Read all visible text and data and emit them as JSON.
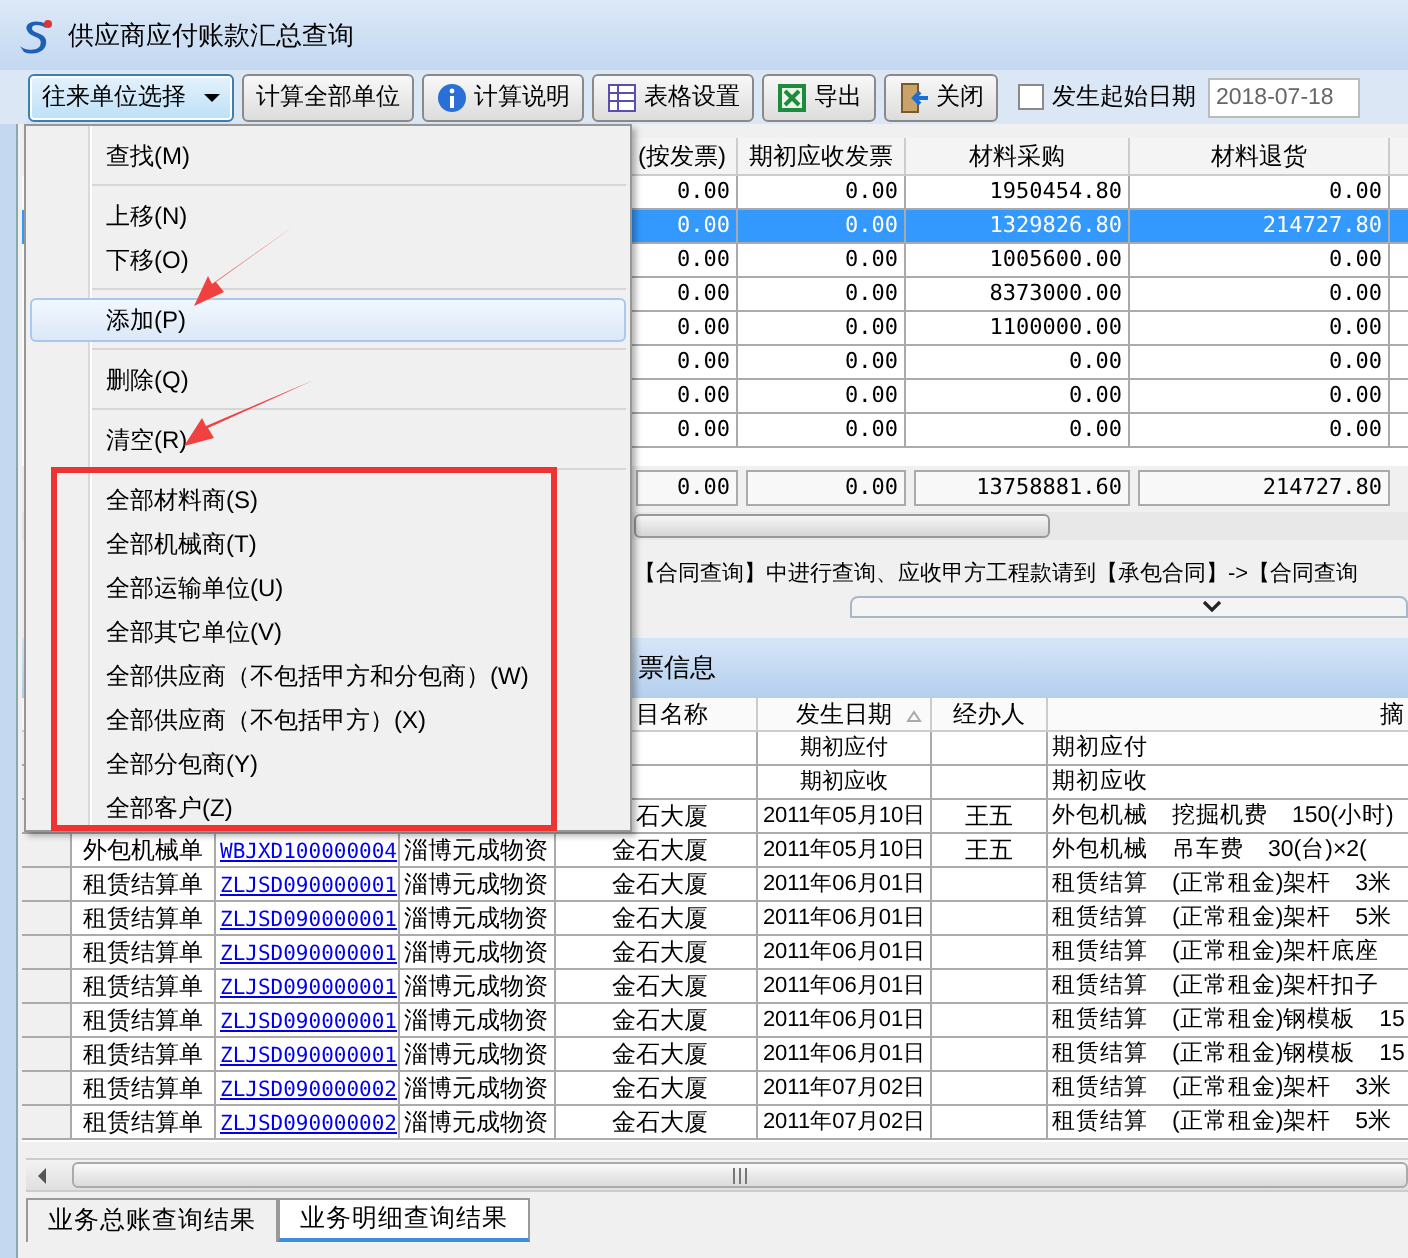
{
  "window": {
    "title": "供应商应付账款汇总查询"
  },
  "toolbar": {
    "dropdown": {
      "label": "往来单位选择"
    },
    "buttons": [
      {
        "label": "计算全部单位",
        "kind": "plain"
      },
      {
        "label": "计算说明",
        "kind": "info"
      },
      {
        "label": "表格设置",
        "kind": "table"
      },
      {
        "label": "导出",
        "kind": "excel"
      },
      {
        "label": "关闭",
        "kind": "exit"
      }
    ],
    "start_date": {
      "label": "发生起始日期",
      "checked": false,
      "value": "2018-07-18"
    }
  },
  "summary_table": {
    "columns": [
      "(按发票)",
      "期初应收发票",
      "材料采购",
      "材料退货"
    ],
    "rows": [
      {
        "cells": [
          "0.00",
          "0.00",
          "1950454.80",
          "0.00"
        ],
        "selected": false
      },
      {
        "cells": [
          "0.00",
          "0.00",
          "1329826.80",
          "214727.80"
        ],
        "selected": true
      },
      {
        "cells": [
          "0.00",
          "0.00",
          "1005600.00",
          "0.00"
        ],
        "selected": false
      },
      {
        "cells": [
          "0.00",
          "0.00",
          "8373000.00",
          "0.00"
        ],
        "selected": false
      },
      {
        "cells": [
          "0.00",
          "0.00",
          "1100000.00",
          "0.00"
        ],
        "selected": false
      },
      {
        "cells": [
          "0.00",
          "0.00",
          "0.00",
          "0.00"
        ],
        "selected": false
      },
      {
        "cells": [
          "0.00",
          "0.00",
          "0.00",
          "0.00"
        ],
        "selected": false
      },
      {
        "cells": [
          "0.00",
          "0.00",
          "0.00",
          "0.00"
        ],
        "selected": false
      }
    ],
    "totals": [
      "0.00",
      "0.00",
      "13758881.60",
      "214727.80"
    ]
  },
  "notice": "【合同查询】中进行查询、应收甲方工程款请到【承包合同】->【合同查询",
  "detail_panel": {
    "title": "票信息",
    "columns": [
      {
        "label": "目名称"
      },
      {
        "label": "发生日期"
      },
      {
        "label": "经办人"
      },
      {
        "label": "摘"
      }
    ],
    "rows": [
      {
        "date": "期初应付",
        "summary": "期初应付"
      },
      {
        "date": "期初应收",
        "summary": "期初应收"
      },
      {
        "project": "石大厦",
        "date": "2011年05月10日",
        "handler": "王五",
        "summary": "外包机械　挖掘机费　150(小时)"
      },
      {
        "type": "外包机械单",
        "number": "WBJXD100000004",
        "supplier": "淄博元成物资",
        "project": "金石大厦",
        "date": "2011年05月10日",
        "handler": "王五",
        "summary": "外包机械　吊车费　30(台)×2("
      },
      {
        "type": "租赁结算单",
        "number": "ZLJSD090000001",
        "supplier": "淄博元成物资",
        "project": "金石大厦",
        "date": "2011年06月01日",
        "summary": "租赁结算　(正常租金)架杆　3米"
      },
      {
        "type": "租赁结算单",
        "number": "ZLJSD090000001",
        "supplier": "淄博元成物资",
        "project": "金石大厦",
        "date": "2011年06月01日",
        "summary": "租赁结算　(正常租金)架杆　5米"
      },
      {
        "type": "租赁结算单",
        "number": "ZLJSD090000001",
        "supplier": "淄博元成物资",
        "project": "金石大厦",
        "date": "2011年06月01日",
        "summary": "租赁结算　(正常租金)架杆底座"
      },
      {
        "type": "租赁结算单",
        "number": "ZLJSD090000001",
        "supplier": "淄博元成物资",
        "project": "金石大厦",
        "date": "2011年06月01日",
        "summary": "租赁结算　(正常租金)架杆扣子"
      },
      {
        "type": "租赁结算单",
        "number": "ZLJSD090000001",
        "supplier": "淄博元成物资",
        "project": "金石大厦",
        "date": "2011年06月01日",
        "summary": "租赁结算　(正常租金)钢模板　15"
      },
      {
        "type": "租赁结算单",
        "number": "ZLJSD090000001",
        "supplier": "淄博元成物资",
        "project": "金石大厦",
        "date": "2011年06月01日",
        "summary": "租赁结算　(正常租金)钢模板　15"
      },
      {
        "type": "租赁结算单",
        "number": "ZLJSD090000002",
        "supplier": "淄博元成物资",
        "project": "金石大厦",
        "date": "2011年07月02日",
        "summary": "租赁结算　(正常租金)架杆　3米"
      },
      {
        "type": "租赁结算单",
        "number": "ZLJSD090000002",
        "supplier": "淄博元成物资",
        "project": "金石大厦",
        "date": "2011年07月02日",
        "summary": "租赁结算　(正常租金)架杆　5米"
      }
    ]
  },
  "tabs": [
    {
      "label": "业务总账查询结果",
      "selected": false
    },
    {
      "label": "业务明细查询结果",
      "selected": true
    }
  ],
  "menu": {
    "items": [
      {
        "kind": "item",
        "label": "查找(M)",
        "selected": false
      },
      {
        "kind": "separator"
      },
      {
        "kind": "item",
        "label": "上移(N)",
        "selected": false
      },
      {
        "kind": "item",
        "label": "下移(O)",
        "selected": false
      },
      {
        "kind": "separator"
      },
      {
        "kind": "item",
        "label": "添加(P)",
        "selected": true
      },
      {
        "kind": "separator"
      },
      {
        "kind": "item",
        "label": "删除(Q)",
        "selected": false
      },
      {
        "kind": "separator"
      },
      {
        "kind": "item",
        "label": "清空(R)",
        "selected": false
      },
      {
        "kind": "separator"
      },
      {
        "kind": "item",
        "label": "全部材料商(S)",
        "selected": false
      },
      {
        "kind": "item",
        "label": "全部机械商(T)",
        "selected": false
      },
      {
        "kind": "item",
        "label": "全部运输单位(U)",
        "selected": false
      },
      {
        "kind": "item",
        "label": "全部其它单位(V)",
        "selected": false
      },
      {
        "kind": "item",
        "label": "全部供应商（不包括甲方和分包商）(W)",
        "selected": false
      },
      {
        "kind": "item",
        "label": "全部供应商（不包括甲方）(X)",
        "selected": false
      },
      {
        "kind": "item",
        "label": "全部分包商(Y)",
        "selected": false
      },
      {
        "kind": "item",
        "label": "全部客户(Z)",
        "selected": false
      }
    ]
  }
}
